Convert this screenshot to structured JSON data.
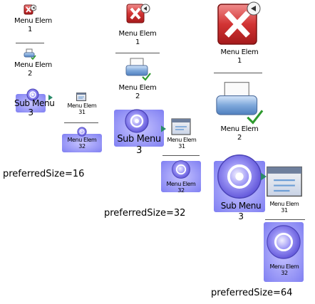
{
  "groups": [
    {
      "caption": "preferredSize=16",
      "items": [
        {
          "label": "Menu Elem\n1",
          "icon": "close-icon"
        },
        {
          "label": "Menu Elem\n2",
          "icon": "printer-icon"
        },
        {
          "label": "Sub Menu\n3",
          "icon": "refresh-disc-icon"
        }
      ],
      "submenu": [
        {
          "label": "Menu Elem\n31",
          "icon": "window-icon"
        },
        {
          "label": "Menu Elem\n32",
          "icon": "refresh-disc-icon"
        }
      ]
    },
    {
      "caption": "preferredSize=32",
      "items": [
        {
          "label": "Menu Elem\n1",
          "icon": "close-icon"
        },
        {
          "label": "Menu Elem\n2",
          "icon": "printer-icon"
        },
        {
          "label": "Sub Menu\n3",
          "icon": "refresh-disc-icon"
        }
      ],
      "submenu": [
        {
          "label": "Menu Elem\n31",
          "icon": "window-icon"
        },
        {
          "label": "Menu Elem\n32",
          "icon": "refresh-disc-icon"
        }
      ]
    },
    {
      "caption": "preferredSize=64",
      "items": [
        {
          "label": "Menu Elem\n1",
          "icon": "close-icon"
        },
        {
          "label": "Menu Elem\n2",
          "icon": "printer-icon"
        },
        {
          "label": "Sub Menu\n3",
          "icon": "refresh-disc-icon"
        }
      ],
      "submenu": [
        {
          "label": "Menu Elem\n31",
          "icon": "window-icon"
        },
        {
          "label": "Menu Elem\n32",
          "icon": "refresh-disc-icon"
        }
      ]
    }
  ],
  "colors": {
    "close_red": "#c8282a",
    "printer_blue": "#6e9fd6",
    "check_green": "#2e9a2e",
    "disc_purple": "#7a74e8",
    "highlight_purple": "#8f8ff0",
    "separator": "#555555"
  }
}
